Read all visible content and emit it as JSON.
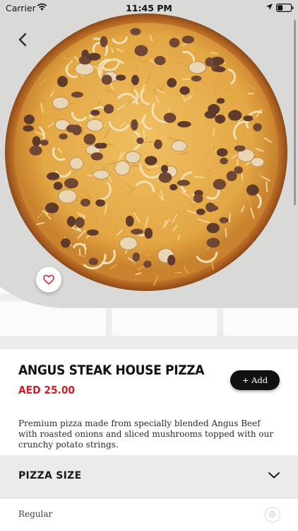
{
  "status_bar": {
    "carrier": "Carrier",
    "time": "11:45 PM"
  },
  "product": {
    "title": "ANGUS STEAK HOUSE PIZZA",
    "price": "AED 25.00",
    "add_label": "+ Add",
    "description": "Premium pizza made from specially blended Angus Beef with roasted onions and sliced mushrooms topped with our crunchy potato strings."
  },
  "size_section": {
    "label": "PIZZA SIZE",
    "options": [
      {
        "label": "Regular",
        "selected": false
      }
    ]
  },
  "colors": {
    "accent_price": "#d3202b",
    "button_bg": "#111111",
    "section_bg": "#ebebea"
  },
  "icons": {
    "back": "chevron-left-icon",
    "favorite": "heart-icon",
    "expand": "chevron-down-icon",
    "wifi": "wifi-icon",
    "location": "location-arrow-icon",
    "battery": "battery-icon"
  }
}
